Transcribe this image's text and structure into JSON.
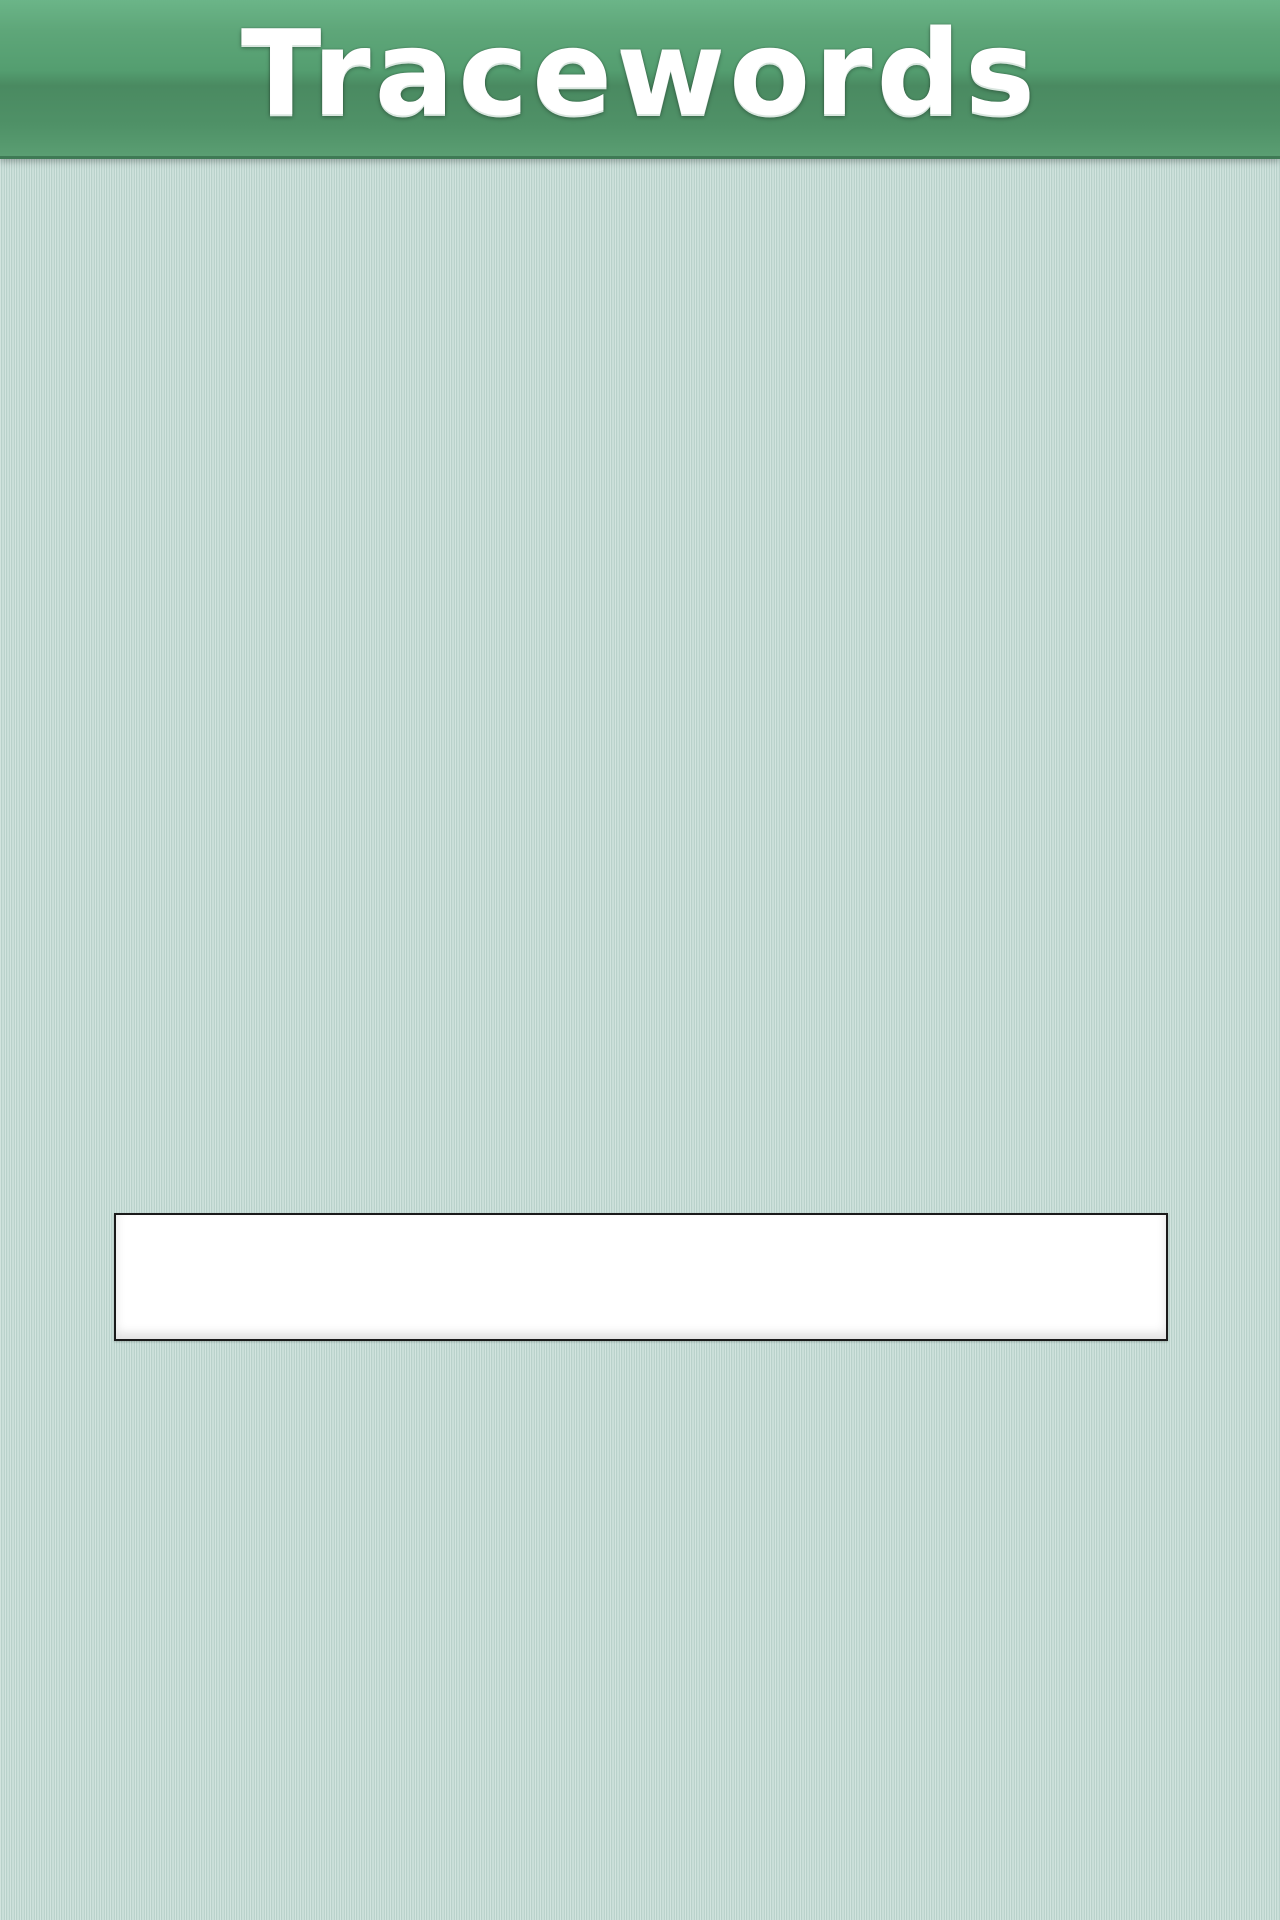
{
  "header": {
    "title": "Tracewords"
  },
  "word_input": {
    "value": "",
    "placeholder": ""
  },
  "colors": {
    "header_green": "#549e70",
    "background": "#c6dcd6",
    "input_background": "#ffffff",
    "input_border": "#1a1a1a"
  }
}
